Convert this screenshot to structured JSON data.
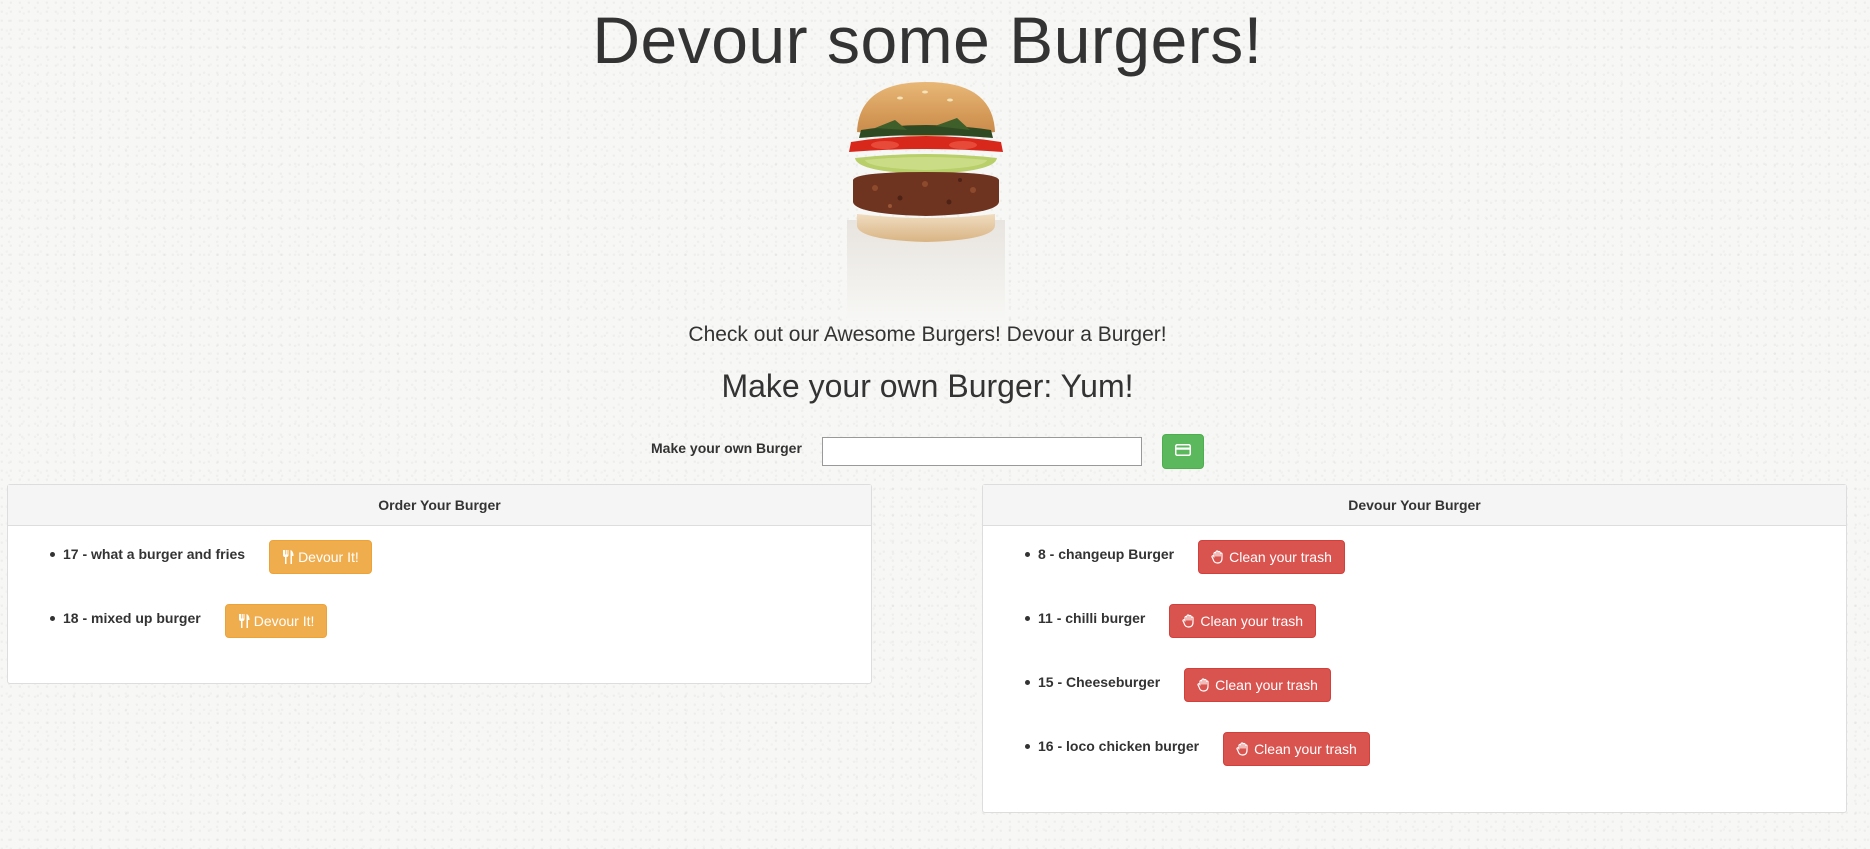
{
  "header": {
    "title": "Devour some Burgers!",
    "tagline": "Check out our Awesome Burgers! Devour a Burger!",
    "subtitle": "Make your own Burger: Yum!"
  },
  "form": {
    "label": "Make your own Burger",
    "input_value": "",
    "submit_icon": "credit-card-icon"
  },
  "order_panel": {
    "heading": "Order Your Burger",
    "button_label": "Devour It!",
    "button_icon": "cutlery-icon",
    "items": [
      {
        "text": "17 - what a burger and fries"
      },
      {
        "text": "18 - mixed up burger"
      }
    ]
  },
  "devour_panel": {
    "heading": "Devour Your Burger",
    "button_label": "Clean your trash",
    "button_icon": "hand-icon",
    "items": [
      {
        "text": "8 - changeup Burger"
      },
      {
        "text": "11 - chilli burger"
      },
      {
        "text": "15 - Cheeseburger"
      },
      {
        "text": "16 - loco chicken burger"
      }
    ]
  },
  "colors": {
    "success": "#5cb85c",
    "warning": "#f0ad4e",
    "danger": "#d9534f"
  }
}
